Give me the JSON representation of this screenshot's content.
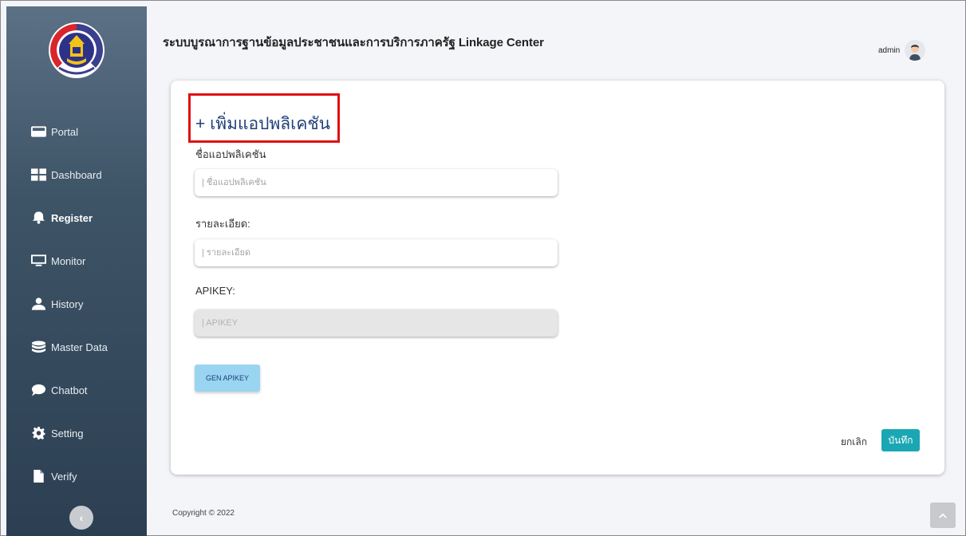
{
  "app": {
    "title": "ระบบบูรณาการฐานข้อมูลประชาชนและการบริการภาครัฐ Linkage Center",
    "user_name": "admin"
  },
  "logo": {
    "text": "กรมการพัฒนาชุมชน"
  },
  "sidebar": {
    "items": [
      {
        "label": "Portal",
        "icon": "card-icon",
        "active": false
      },
      {
        "label": "Dashboard",
        "icon": "grid-icon",
        "active": false
      },
      {
        "label": "Register",
        "icon": "bell-icon",
        "active": true
      },
      {
        "label": "Monitor",
        "icon": "monitor-icon",
        "active": false
      },
      {
        "label": "History",
        "icon": "user-icon",
        "active": false
      },
      {
        "label": "Master Data",
        "icon": "database-icon",
        "active": false
      },
      {
        "label": "Chatbot",
        "icon": "chat-bubble-icon",
        "active": false
      },
      {
        "label": "Setting",
        "icon": "gear-icon",
        "active": false
      },
      {
        "label": "Verify",
        "icon": "file-icon",
        "active": false
      }
    ],
    "collapse_glyph": "‹"
  },
  "form": {
    "title": "+ เพิ่มแอปพลิเคชัน",
    "app_name_label": "ชื่อแอปพลิเคชัน",
    "app_name_placeholder": "| ชื่อแอปพลิเคชัน",
    "app_name_value": "",
    "detail_label": "รายละเอียด:",
    "detail_placeholder": "| รายละเอียด",
    "detail_value": "",
    "apikey_label": "APIKEY:",
    "apikey_placeholder": "| APIKEY",
    "apikey_value": "",
    "gen_button": "GEN APIKEY",
    "cancel": "ยกเลิก",
    "save": "บันทึก"
  },
  "footer": {
    "copyright": "Copyright © 2022"
  },
  "colors": {
    "sidebar_top": "#5c7186",
    "sidebar_bottom": "#2c3f52",
    "title_blue": "#1f3f77",
    "gen_button_bg": "#99d5f1",
    "save_button_bg": "#1aa7b3",
    "highlight_red": "#e01010"
  }
}
